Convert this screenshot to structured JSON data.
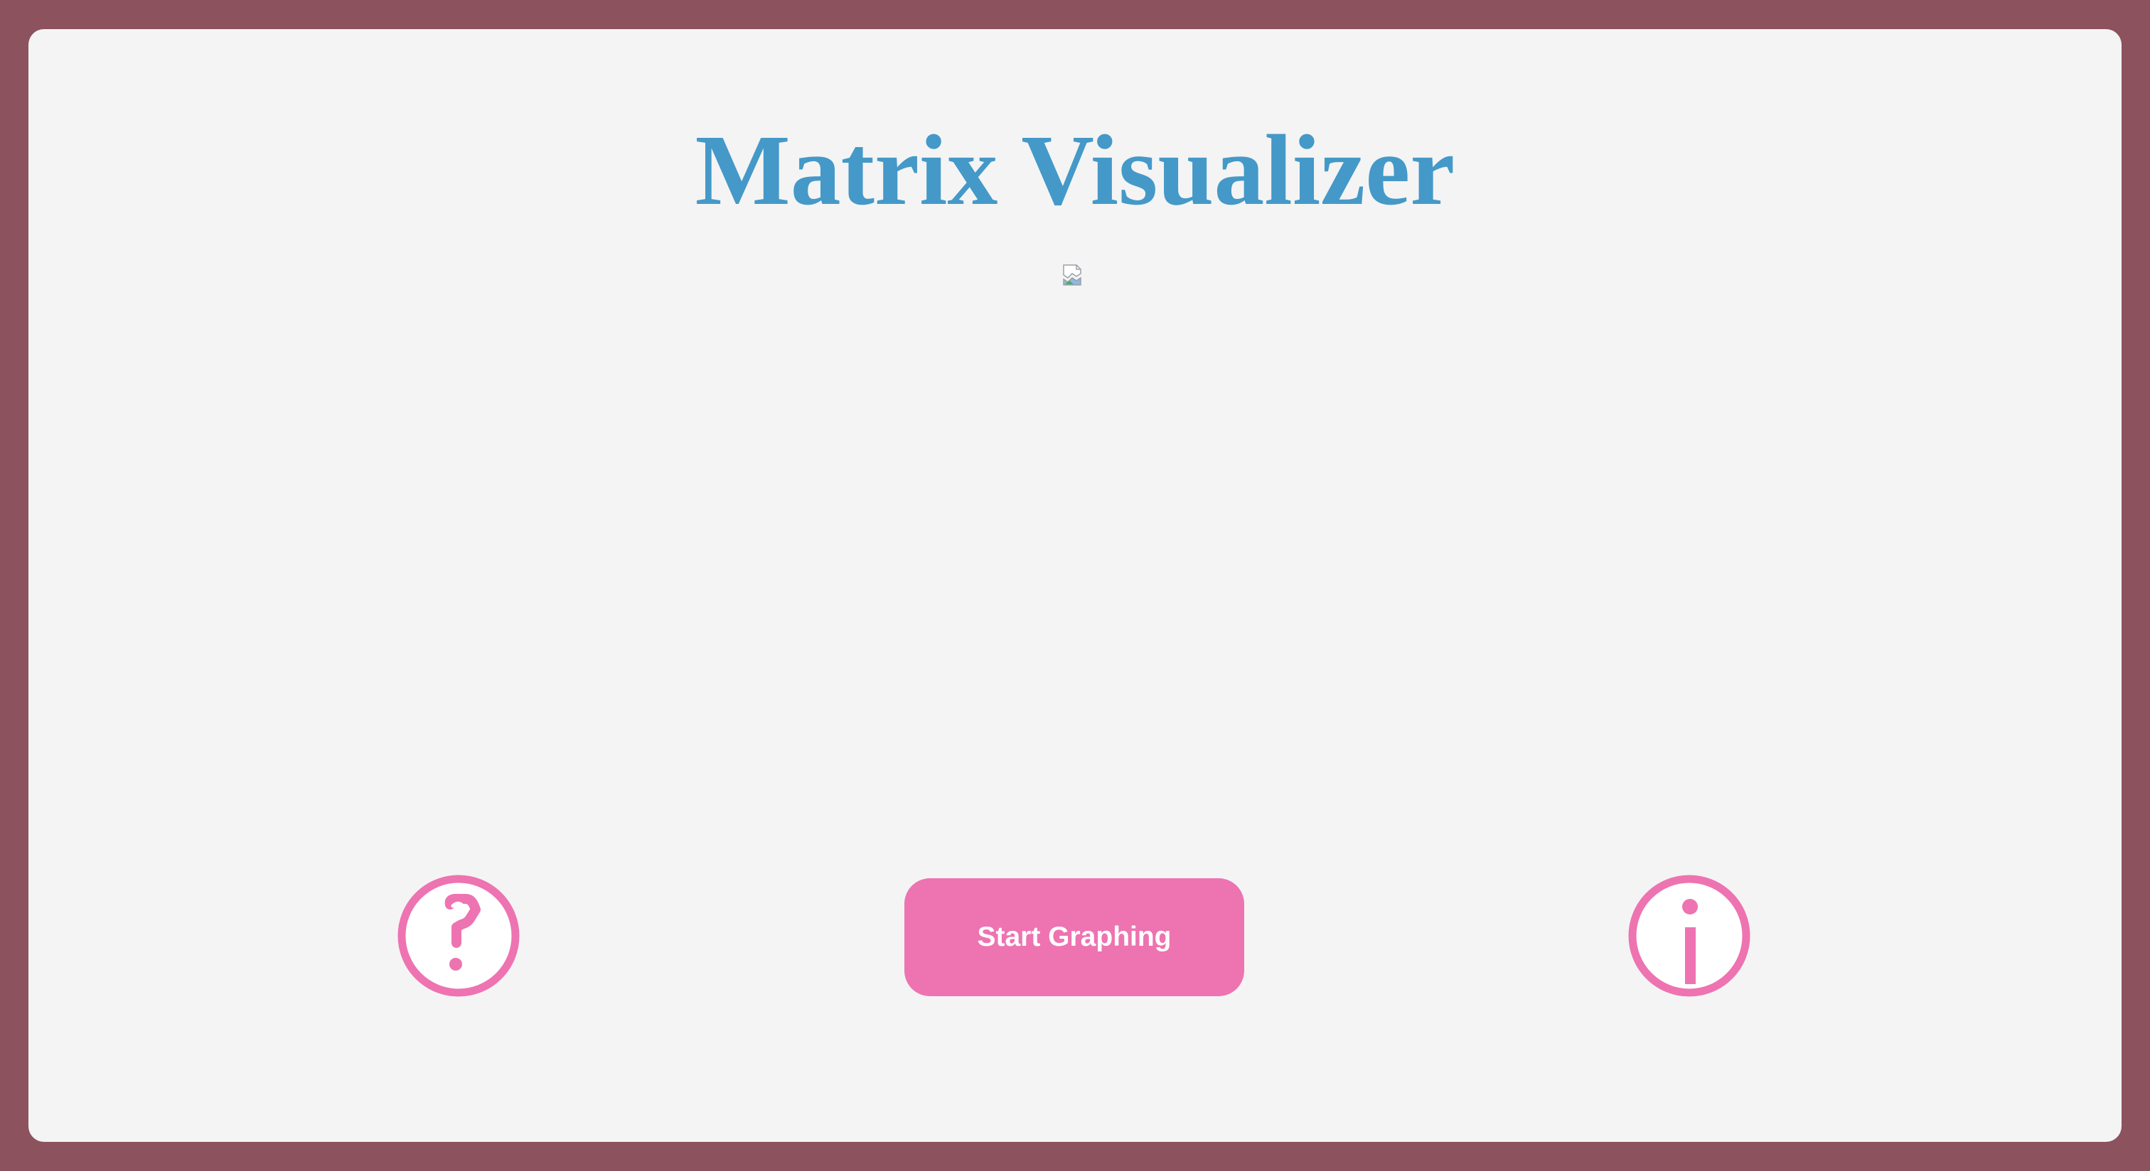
{
  "app": {
    "title": "Matrix Visualizer"
  },
  "main": {
    "start_button_label": "Start Graphing"
  },
  "icons": {
    "help": "question-mark-icon",
    "info": "info-icon",
    "image": "broken-image-icon"
  },
  "colors": {
    "frame": "#8c525e",
    "panel": "#f4f4f4",
    "title": "#4499c8",
    "accent": "#ee73b1"
  }
}
